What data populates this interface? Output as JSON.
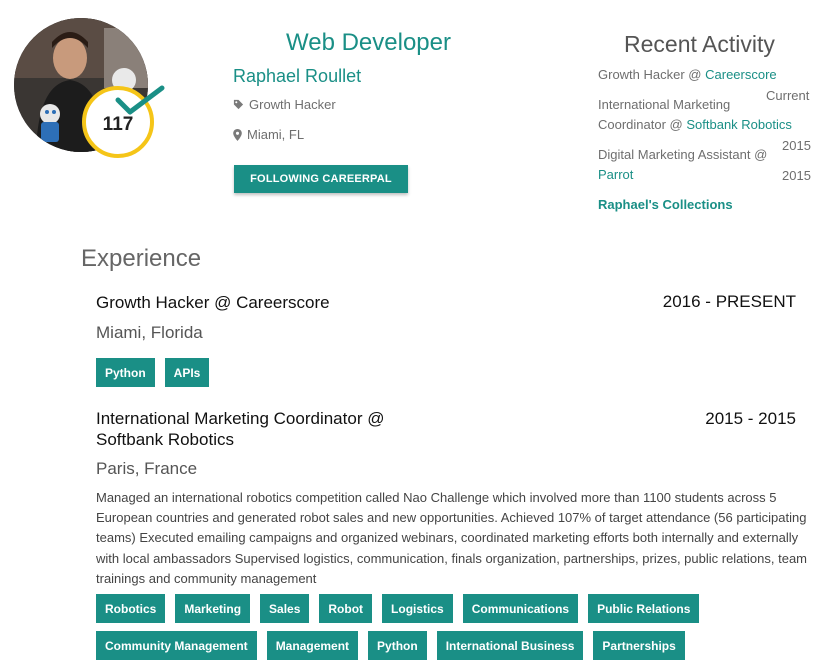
{
  "profile": {
    "score": "117",
    "headline": "Web Developer",
    "name": "Raphael Roullet",
    "tag": "Growth Hacker",
    "location": "Miami, FL",
    "follow_label": "FOLLOWING CAREERPAL",
    "accent_color": "#1a8f86",
    "badge_color": "#f5c518"
  },
  "recent": {
    "title": "Recent Activity",
    "items": [
      {
        "role": "Growth Hacker @ ",
        "company": "Careerscore",
        "date": "Current"
      },
      {
        "role_line1": "International Marketing",
        "role_line2": "Coordinator @ ",
        "company": "Softbank Robotics",
        "date": "2015"
      },
      {
        "role": "Digital Marketing Assistant @",
        "company": "Parrot",
        "date": "2015"
      }
    ],
    "collections_label": "Raphael's Collections"
  },
  "experience": {
    "title": "Experience",
    "jobs": [
      {
        "title": "Growth Hacker @ Careerscore",
        "dates": "2016 - PRESENT",
        "location": "Miami, Florida",
        "skills": [
          "Python",
          "APIs"
        ]
      },
      {
        "title_line1": "International Marketing Coordinator @",
        "title_line2": "Softbank Robotics",
        "dates": "2015 - 2015",
        "location": "Paris, France",
        "description": "Managed an international robotics competition called Nao Challenge which involved more than 1100 students across 5 European countries and generated robot sales and new opportunities. Achieved 107% of target attendance (56 participating teams) Executed emailing campaigns and organized webinars, coordinated marketing efforts both internally and externally with local ambassadors Supervised logistics, communication, finals organization, partnerships, prizes, public relations, team trainings and community management",
        "skills": [
          "Robotics",
          "Marketing",
          "Sales",
          "Robot",
          "Logistics",
          "Communications",
          "Public Relations",
          "Community Management",
          "Management",
          "Python",
          "International Business",
          "Partnerships"
        ]
      }
    ]
  }
}
